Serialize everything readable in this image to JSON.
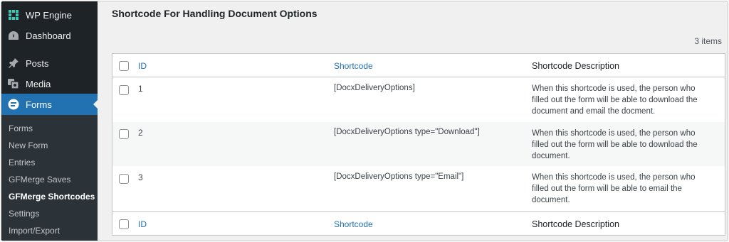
{
  "sidebar": {
    "top_items": [
      {
        "label": "WP Engine",
        "icon": "wp-engine-icon"
      },
      {
        "label": "Dashboard",
        "icon": "dashboard-icon"
      },
      {
        "label": "Posts",
        "icon": "pin-icon"
      },
      {
        "label": "Media",
        "icon": "media-icon"
      },
      {
        "label": "Forms",
        "icon": "forms-icon",
        "active": true
      }
    ],
    "submenu": [
      {
        "label": "Forms"
      },
      {
        "label": "New Form"
      },
      {
        "label": "Entries"
      },
      {
        "label": "GFMerge Saves"
      },
      {
        "label": "GFMerge Shortcodes",
        "current": true
      },
      {
        "label": "Settings"
      },
      {
        "label": "Import/Export"
      }
    ]
  },
  "main": {
    "title": "Shortcode For Handling Document Options",
    "items_count": "3 items",
    "table": {
      "columns": {
        "id": "ID",
        "shortcode": "Shortcode",
        "description": "Shortcode Description"
      },
      "rows": [
        {
          "id": "1",
          "shortcode": "[DocxDeliveryOptions]",
          "description": "When this shortcode is used, the person who filled out the form will be able to download the document and email the docment."
        },
        {
          "id": "2",
          "shortcode": "[DocxDeliveryOptions type=\"Download\"]",
          "description": "When this shortcode is used, the person who filled out the form will be able to download the document."
        },
        {
          "id": "3",
          "shortcode": "[DocxDeliveryOptions type=\"Email\"]",
          "description": "When this shortcode is used, the person who filled out the form will be able to email the document."
        }
      ]
    }
  },
  "colors": {
    "sidebar_bg": "#1d2327",
    "submenu_bg": "#2c3338",
    "accent": "#2271b1",
    "page_bg": "#f0f0f1"
  }
}
